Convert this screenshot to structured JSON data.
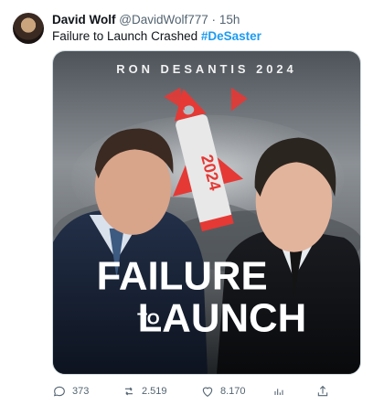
{
  "user": {
    "name": "David Wolf",
    "handle": "@DavidWolf777",
    "separator": "·",
    "time": "15h"
  },
  "tweet": {
    "text": "Failure to Launch Crashed ",
    "hashtag": "#DeSaster"
  },
  "poster": {
    "header": "RON DESANTIS 2024",
    "rocket_label": "2024",
    "title_line1": "FAILURE",
    "title_to": "TO",
    "title_line2": "LAUNCH"
  },
  "actions": {
    "replies": "373",
    "retweets": "2.519",
    "likes": "8.170"
  },
  "colors": {
    "link": "#1d9bf0",
    "muted": "#536471",
    "rocket": "#e53935"
  },
  "icons": [
    "reply-icon",
    "retweet-icon",
    "like-icon",
    "views-icon",
    "share-icon"
  ]
}
